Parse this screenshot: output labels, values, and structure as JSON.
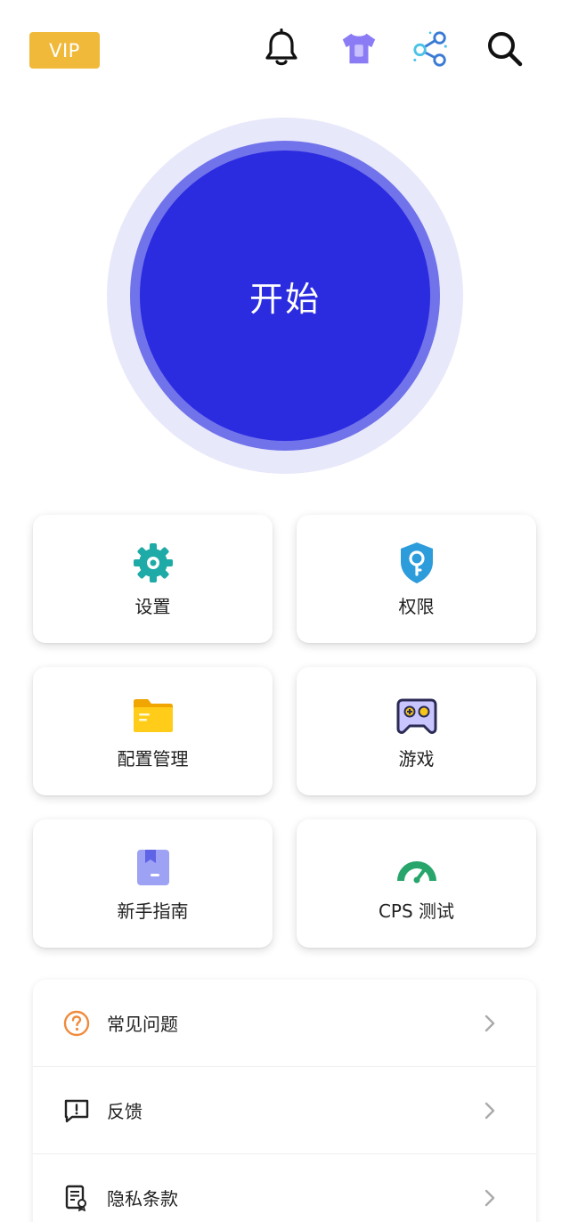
{
  "header": {
    "vip_label": "VIP",
    "icons": [
      "bell-icon",
      "shirt-icon",
      "share-icon",
      "search-icon"
    ]
  },
  "start": {
    "label": "开始"
  },
  "tiles": [
    {
      "label": "设置",
      "icon": "gear-icon"
    },
    {
      "label": "权限",
      "icon": "shield-key-icon"
    },
    {
      "label": "配置管理",
      "icon": "folder-icon"
    },
    {
      "label": "游戏",
      "icon": "gamepad-icon"
    },
    {
      "label": "新手指南",
      "icon": "book-icon"
    },
    {
      "label": "CPS 测试",
      "icon": "speedometer-icon"
    }
  ],
  "list": [
    {
      "label": "常见问题",
      "icon": "help-circle-icon"
    },
    {
      "label": "反馈",
      "icon": "feedback-icon"
    },
    {
      "label": "隐私条款",
      "icon": "document-icon"
    }
  ],
  "colors": {
    "vip": "#f0b93a",
    "start_primary": "#2b2be0",
    "start_ring": "#7173ea",
    "start_halo": "#e8e8fb",
    "gear": "#1eaaa6",
    "shield": "#2d9cdb",
    "folder": "#f5b800",
    "gamepad": "#5b5fc7",
    "book": "#9da2f5",
    "speedometer": "#27a56a",
    "help": "#f08a3c"
  }
}
